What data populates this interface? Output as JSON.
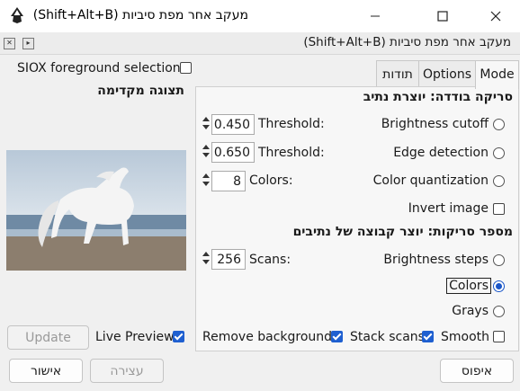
{
  "window": {
    "title": "מעקב אחר מפת סיביות (Shift+Alt+B)",
    "minimize": "—",
    "maximize": "☐",
    "close": "✕"
  },
  "dock": {
    "title": "מעקב אחר מפת סיביות (Shift+Alt+B)"
  },
  "siox": {
    "label": "SIOX foreground selection",
    "checked": false
  },
  "tabs": [
    "Mode",
    "Options",
    "תודות"
  ],
  "preview": {
    "heading": "תצוגה מקדימה",
    "update_label": "Update",
    "live_preview_label": "Live Preview"
  },
  "single_scan": {
    "title": "סריקה בודדה: יוצרת נתיב",
    "rows": [
      {
        "label": "Brightness cutoff",
        "param": "Threshold:",
        "value": "0.450",
        "selected": false
      },
      {
        "label": "Edge detection",
        "param": "Threshold:",
        "value": "0.650",
        "selected": false
      },
      {
        "label": "Color quantization",
        "param": "Colors:",
        "value": "8",
        "selected": false
      }
    ],
    "invert_label": "Invert image"
  },
  "multi_scan": {
    "title": "מספר סריקות: יוצר קבוצה של נתיבים",
    "scans_param": "Scans:",
    "scans_value": "256",
    "options": [
      "Brightness steps",
      "Colors",
      "Grays"
    ],
    "selected": "Colors",
    "remove_background_label": "Remove background",
    "stack_scans_label": "Stack scans",
    "smooth_label": "Smooth"
  },
  "buttons": {
    "reset": "איפוס",
    "stop": "עצירה",
    "ok": "אישור"
  },
  "colors": {
    "accent": "#1e5fd0"
  }
}
